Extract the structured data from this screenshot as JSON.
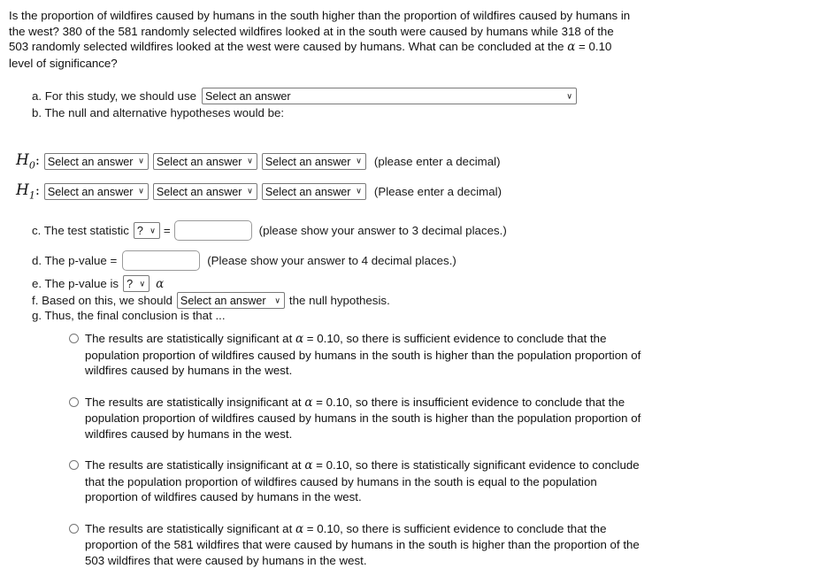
{
  "question": {
    "text": "Is the proportion of wildfires caused by humans in the south higher than the proportion of wildfires caused by humans in the west? 380 of the 581 randomly selected wildfires looked at in the south were caused by humans while 318 of the 503 randomly selected wildfires looked at the west were caused by humans. What can be concluded at the α = 0.10 level of significance?"
  },
  "parts": {
    "a_label": "a. For this study, we should use",
    "a_select_value": "Select an answer",
    "b_label": "b. The null and alternative hypotheses would be:",
    "c_label": "c. The test statistic",
    "c_select_value": "?",
    "c_equals": "=",
    "c_input_value": "",
    "c_note": "(please show your answer to 3 decimal places.)",
    "d_label": "d. The p-value =",
    "d_input_value": "",
    "d_note": "(Please show your answer to 4 decimal places.)",
    "e_label": "e. The p-value is",
    "e_select_value": "?",
    "e_alpha": "α",
    "f_label": "f. Based on this, we should",
    "f_select_value": "Select an answer",
    "f_suffix": "the null hypothesis.",
    "g_label": "g. Thus, the final conclusion is that ..."
  },
  "hypotheses": {
    "h0": {
      "symbol": "H",
      "subscript": "0",
      "colon": ":",
      "select1": "Select an answer",
      "select2": "Select an answer",
      "select3": "Select an answer",
      "note": "(please enter a decimal)"
    },
    "h1": {
      "symbol": "H",
      "subscript": "1",
      "colon": ":",
      "select1": "Select an answer",
      "select2": "Select an answer",
      "select3": "Select an answer",
      "note": "(Please enter a decimal)"
    }
  },
  "conclusion_options": [
    {
      "id": "option-1",
      "selected": false,
      "text": "The results are statistically significant at α = 0.10, so there is sufficient evidence to conclude that the population proportion of wildfires caused by humans in the south is higher than the population proportion of wildfires caused by humans in the west."
    },
    {
      "id": "option-2",
      "selected": false,
      "text": "The results are statistically insignificant at α = 0.10, so there is insufficient evidence to conclude that the population proportion of wildfires caused by humans in the south is higher than the population proportion of wildfires caused by humans in the west."
    },
    {
      "id": "option-3",
      "selected": false,
      "text": "The results are statistically insignificant at α = 0.10, so there is statistically significant evidence to conclude that the population proportion of wildfires caused by humans in the south is equal to the population proportion of wildfires caused by humans in the west."
    },
    {
      "id": "option-4",
      "selected": false,
      "text": "The results are statistically significant at α = 0.10, so there is sufficient evidence to conclude that the proportion of the 581 wildfires that were caused by humans in the south is higher than the proportion of the 503 wildfires that were caused by humans in the west."
    }
  ],
  "icons": {
    "chevron_down": "∨"
  },
  "colors": {
    "text": "#111111",
    "border": "#7a7a7a",
    "background": "#ffffff"
  }
}
